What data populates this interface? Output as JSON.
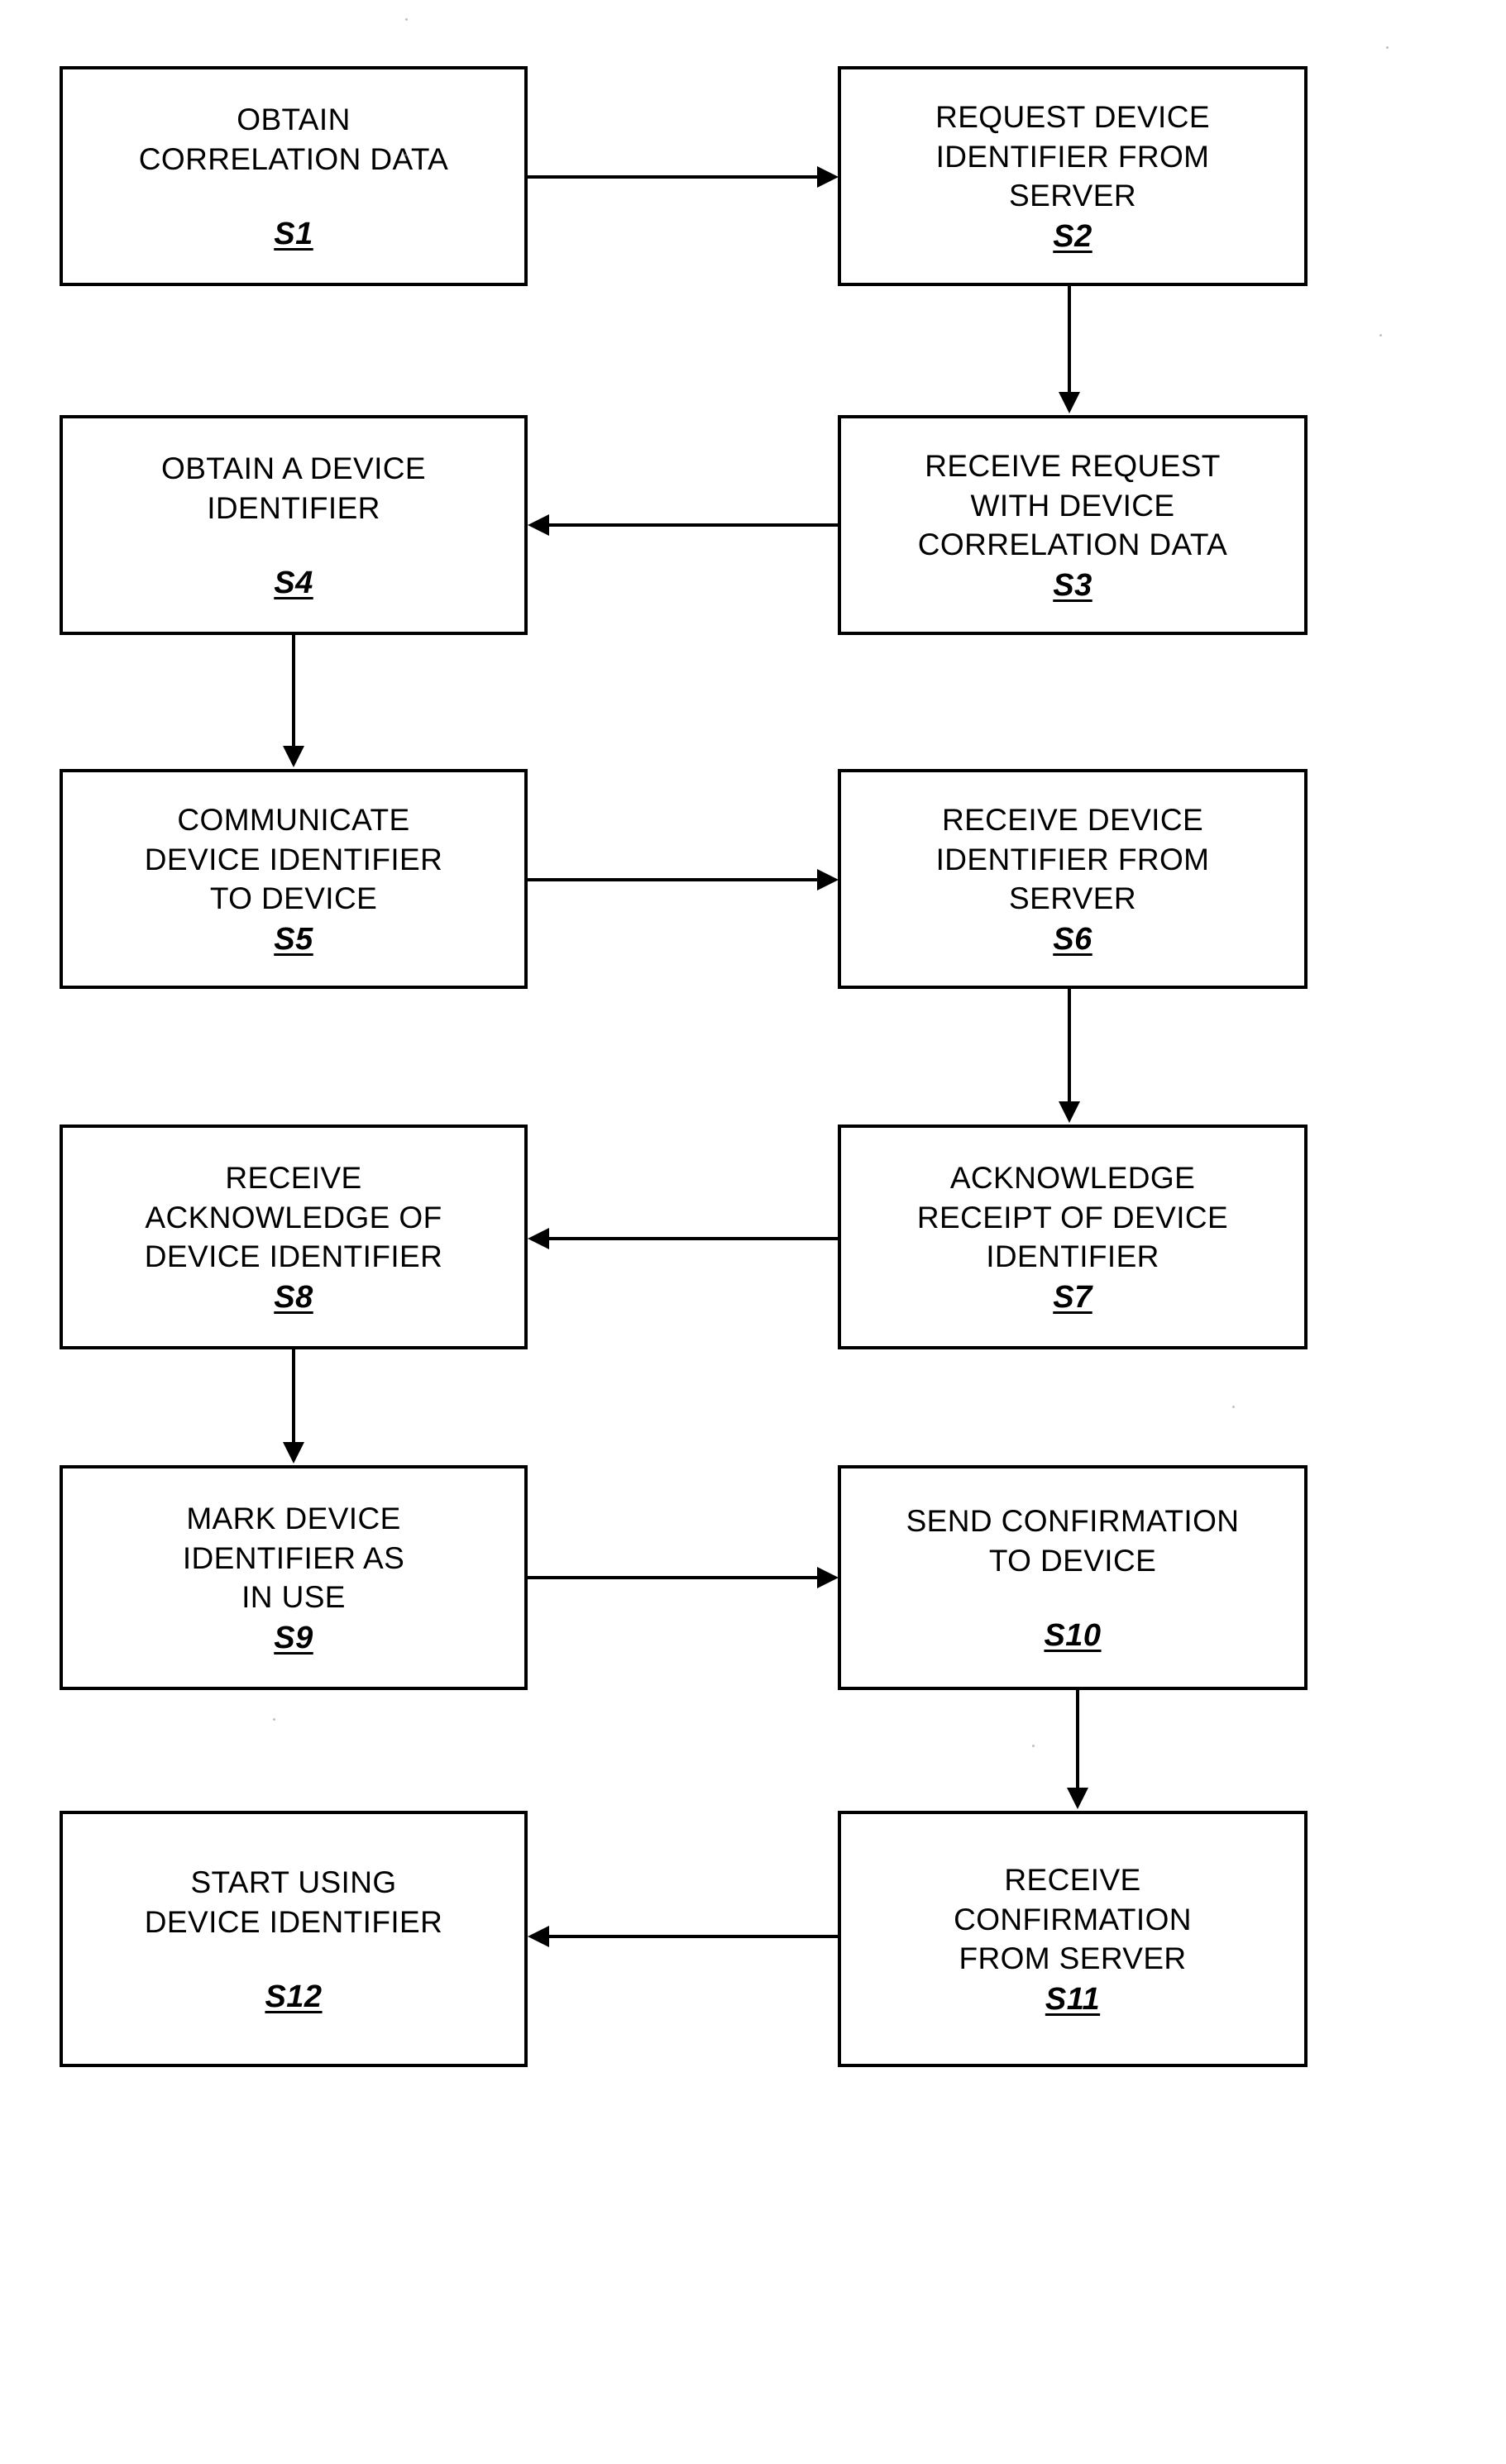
{
  "figure": {
    "type": "flowchart",
    "orientation": "two-column device/server swimlane sequence",
    "background_color": "#ffffff",
    "line_color": "#000000"
  },
  "nodes": [
    {
      "id": "S1",
      "step_label": "S1",
      "lines": [
        "OBTAIN",
        "CORRELATION DATA"
      ],
      "column": "left",
      "row": 1
    },
    {
      "id": "S2",
      "step_label": "S2",
      "lines": [
        "REQUEST DEVICE",
        "IDENTIFIER FROM",
        "SERVER"
      ],
      "column": "right",
      "row": 1
    },
    {
      "id": "S3",
      "step_label": "S3",
      "lines": [
        "RECEIVE REQUEST",
        "WITH DEVICE",
        "CORRELATION DATA"
      ],
      "column": "right",
      "row": 2
    },
    {
      "id": "S4",
      "step_label": "S4",
      "lines": [
        "OBTAIN A DEVICE",
        "IDENTIFIER"
      ],
      "column": "left",
      "row": 2
    },
    {
      "id": "S5",
      "step_label": "S5",
      "lines": [
        "COMMUNICATE",
        "DEVICE IDENTIFIER",
        "TO DEVICE"
      ],
      "column": "left",
      "row": 3
    },
    {
      "id": "S6",
      "step_label": "S6",
      "lines": [
        "RECEIVE DEVICE",
        "IDENTIFIER FROM",
        "SERVER"
      ],
      "column": "right",
      "row": 3
    },
    {
      "id": "S7",
      "step_label": "S7",
      "lines": [
        "ACKNOWLEDGE",
        "RECEIPT OF DEVICE",
        "IDENTIFIER"
      ],
      "column": "right",
      "row": 4
    },
    {
      "id": "S8",
      "step_label": "S8",
      "lines": [
        "RECEIVE",
        "ACKNOWLEDGE OF",
        "DEVICE IDENTIFIER"
      ],
      "column": "left",
      "row": 4
    },
    {
      "id": "S9",
      "step_label": "S9",
      "lines": [
        "MARK DEVICE",
        "IDENTIFIER AS",
        "IN USE"
      ],
      "column": "left",
      "row": 5
    },
    {
      "id": "S10",
      "step_label": "S10",
      "lines": [
        "SEND CONFIRMATION",
        "TO DEVICE"
      ],
      "column": "right",
      "row": 5
    },
    {
      "id": "S11",
      "step_label": "S11",
      "lines": [
        "RECEIVE",
        "CONFIRMATION",
        "FROM SERVER"
      ],
      "column": "right",
      "row": 6
    },
    {
      "id": "S12",
      "step_label": "S12",
      "lines": [
        "START USING",
        "DEVICE IDENTIFIER"
      ],
      "column": "left",
      "row": 6
    }
  ],
  "edges": [
    {
      "from": "S1",
      "to": "S2",
      "direction": "right"
    },
    {
      "from": "S2",
      "to": "S3",
      "direction": "down"
    },
    {
      "from": "S3",
      "to": "S4",
      "direction": "left"
    },
    {
      "from": "S4",
      "to": "S5",
      "direction": "down"
    },
    {
      "from": "S5",
      "to": "S6",
      "direction": "right"
    },
    {
      "from": "S6",
      "to": "S7",
      "direction": "down"
    },
    {
      "from": "S7",
      "to": "S8",
      "direction": "left"
    },
    {
      "from": "S8",
      "to": "S9",
      "direction": "down"
    },
    {
      "from": "S9",
      "to": "S10",
      "direction": "right"
    },
    {
      "from": "S10",
      "to": "S11",
      "direction": "down"
    },
    {
      "from": "S11",
      "to": "S12",
      "direction": "left"
    }
  ]
}
